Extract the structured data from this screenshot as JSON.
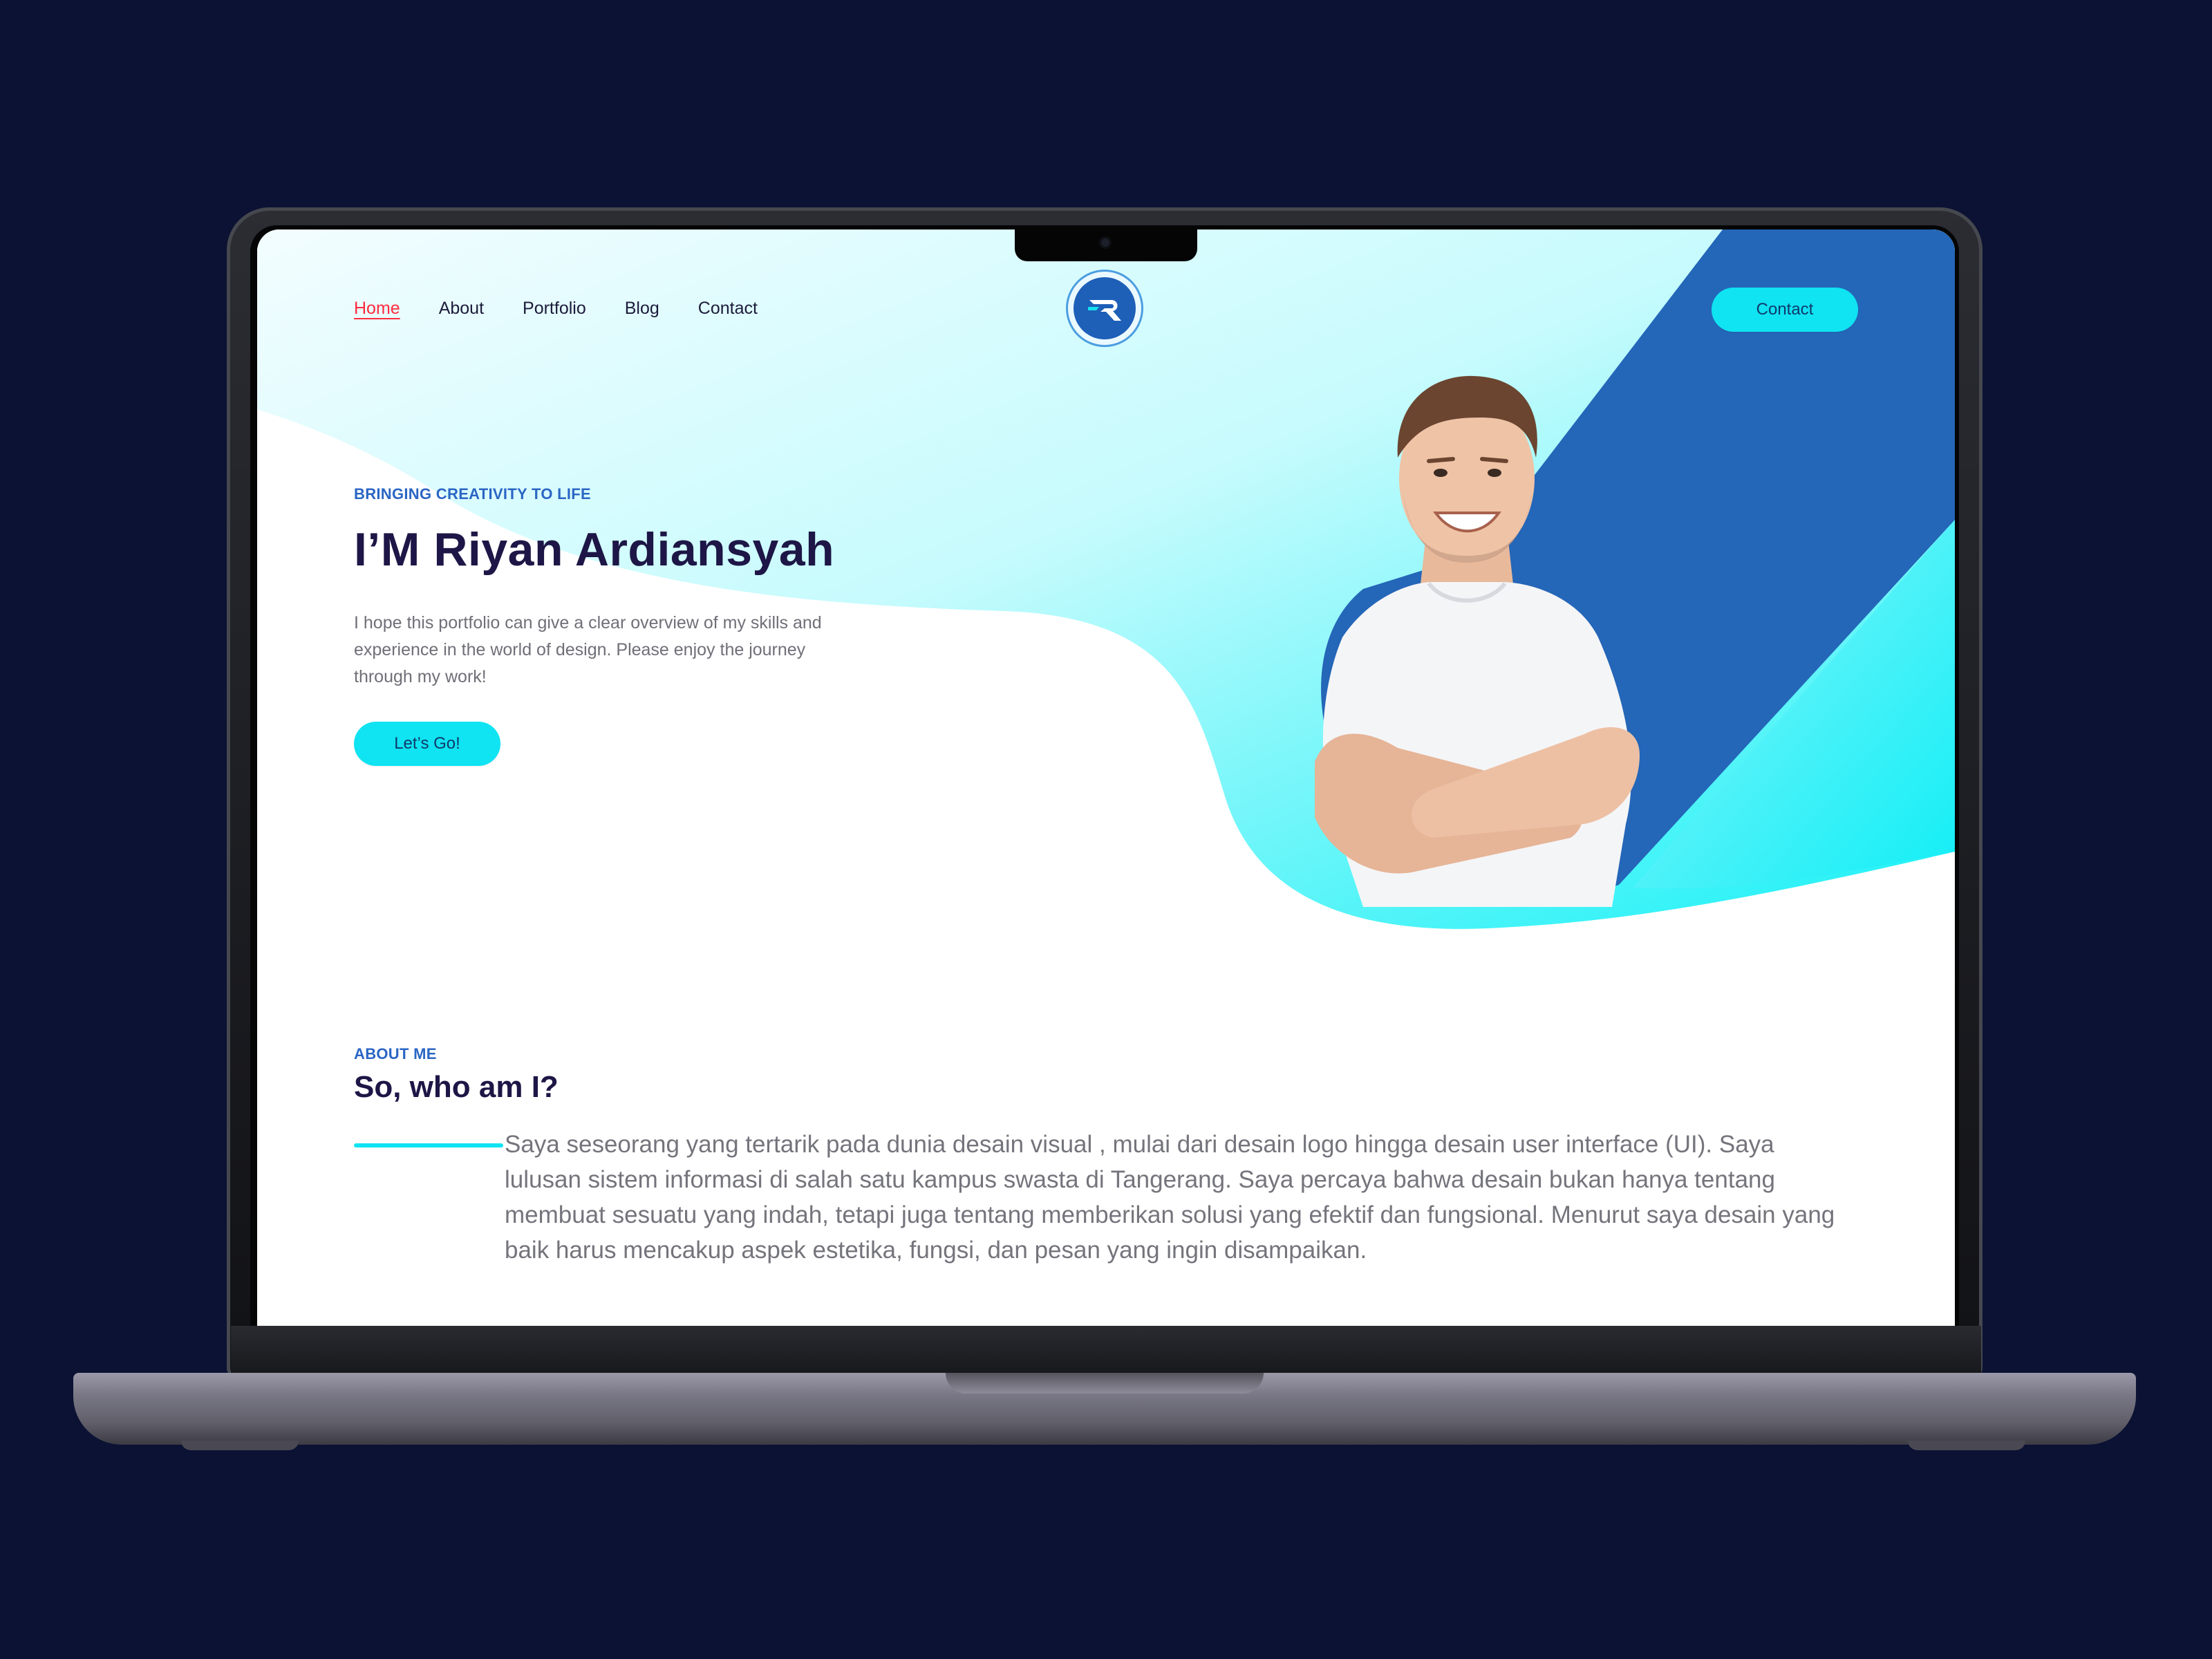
{
  "nav": {
    "items": [
      "Home",
      "About",
      "Portfolio",
      "Blog",
      "Contact"
    ],
    "active": "Home"
  },
  "header": {
    "contact_button": "Contact"
  },
  "hero": {
    "eyebrow": "BRINGING CREATIVITY TO LIFE",
    "title": "I’M Riyan Ardiansyah",
    "description": "I hope this portfolio can give a clear overview of my skills and experience in the world of design. Please enjoy the journey through my work!",
    "cta": "Let’s Go!"
  },
  "about": {
    "eyebrow": "ABOUT ME",
    "title": "So, who am I?",
    "text": "Saya seseorang yang tertarik pada dunia desain visual , mulai dari desain logo hingga  desain  user interface (UI). Saya lulusan sistem informasi di salah satu kampus swasta di Tangerang. Saya percaya bahwa desain bukan hanya tentang membuat sesuatu yang indah, tetapi juga tentang memberikan solusi yang efektif dan fungsional. Menurut saya desain yang baik harus mencakup aspek estetika, fungsi, dan pesan yang ingin disampaikan."
  },
  "colors": {
    "page_background": "#0b1233",
    "accent_cyan": "#10e3f2",
    "accent_blue": "#2466b8",
    "title": "#1d1646",
    "nav_active": "#ff2a3d"
  },
  "icons": {
    "logo": "logo-r-mark",
    "portrait": "person-portrait"
  }
}
